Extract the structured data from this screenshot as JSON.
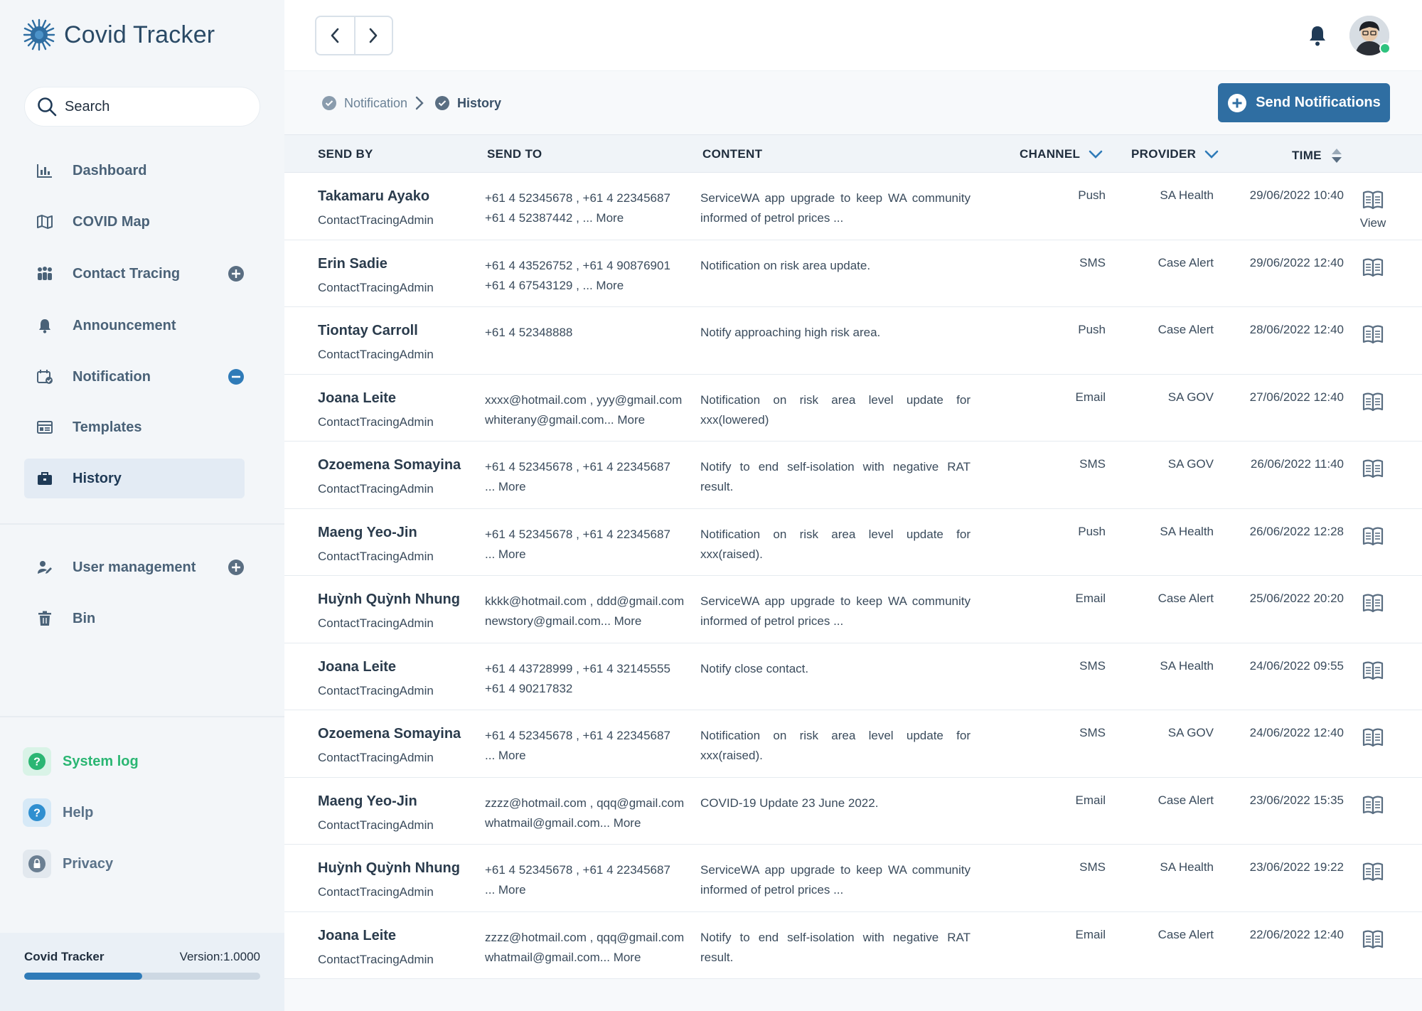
{
  "app": {
    "title": "Covid Tracker"
  },
  "search": {
    "placeholder": "Search"
  },
  "sidebar": {
    "items": [
      {
        "label": "Dashboard",
        "icon": "chart-icon",
        "badge": null,
        "active": false
      },
      {
        "label": "COVID Map",
        "icon": "map-icon",
        "badge": null,
        "active": false
      },
      {
        "label": "Contact Tracing",
        "icon": "people-icon",
        "badge": "plus-circle-icon",
        "active": false
      },
      {
        "label": "Announcement",
        "icon": "bell-icon",
        "badge": null,
        "active": false
      },
      {
        "label": "Notification",
        "icon": "calendar-check-icon",
        "badge": "minus-circle-icon",
        "active": false
      },
      {
        "label": "Templates",
        "icon": "template-icon",
        "badge": null,
        "active": false
      },
      {
        "label": "History",
        "icon": "briefcase-icon",
        "badge": null,
        "active": true
      }
    ],
    "admin_items": [
      {
        "label": "User management",
        "icon": "user-edit-icon",
        "badge": "plus-circle-icon"
      },
      {
        "label": "Bin",
        "icon": "trash-icon",
        "badge": null
      }
    ],
    "footer_items": [
      {
        "label": "System log",
        "icon": "question-icon",
        "color": "#2bb673"
      },
      {
        "label": "Help",
        "icon": "question-icon",
        "color": "#2f8fd0"
      },
      {
        "label": "Privacy",
        "icon": "lock-icon",
        "color": "#6b7f92"
      }
    ],
    "version": {
      "name": "Covid Tracker",
      "label": "Version:1.0000",
      "progress": 0.5
    }
  },
  "breadcrumb": {
    "parent": "Notification",
    "current": "History"
  },
  "actions": {
    "send_label": "Send Notifications"
  },
  "colors": {
    "accent": "#2f6ea2",
    "online": "#2ec27e"
  },
  "table": {
    "columns": {
      "send_by": "SEND BY",
      "send_to": "SEND TO",
      "content": "CONTENT",
      "channel": "CHANNEL",
      "provider": "PROVIDER",
      "time": "TIME"
    },
    "view_label": "View",
    "rows": [
      {
        "name": "Takamaru Ayako",
        "role": "ContactTracingAdmin",
        "to1": "+61 4 52345678 , +61 4 22345687",
        "to2": "+61 4 52387442 , ... More",
        "content": "ServiceWA app upgrade to keep WA community informed of petrol prices ...",
        "channel": "Push",
        "provider": "SA Health",
        "time": "29/06/2022 10:40",
        "show_view_label": true
      },
      {
        "name": "Erin Sadie",
        "role": "ContactTracingAdmin",
        "to1": "+61 4 43526752 , +61 4 90876901",
        "to2": "+61 4 67543129 , ... More",
        "content": "Notification on risk area update.",
        "channel": "SMS",
        "provider": "Case Alert",
        "time": "29/06/2022 12:40",
        "show_view_label": false
      },
      {
        "name": "Tiontay Carroll",
        "role": "ContactTracingAdmin",
        "to1": "+61 4 52348888",
        "to2": "",
        "content": "Notify approaching high risk area.",
        "channel": "Push",
        "provider": "Case Alert",
        "time": "28/06/2022 12:40",
        "show_view_label": false
      },
      {
        "name": "Joana Leite",
        "role": "ContactTracingAdmin",
        "to1": "xxxx@hotmail.com , yyy@gmail.com",
        "to2": "whiterany@gmail.com... More",
        "content": "Notification on risk area level update for xxx(lowered)",
        "channel": "Email",
        "provider": "SA GOV",
        "time": "27/06/2022 12:40",
        "show_view_label": false
      },
      {
        "name": "Ozoemena Somayina",
        "role": "ContactTracingAdmin",
        "to1": "+61 4 52345678 , +61 4 22345687",
        "to2": "... More",
        "content": "Notify to end self-isolation with negative RAT result.",
        "channel": "SMS",
        "provider": "SA GOV",
        "time": "26/06/2022 11:40",
        "show_view_label": false
      },
      {
        "name": "Maeng Yeo-Jin",
        "role": "ContactTracingAdmin",
        "to1": "+61 4 52345678 , +61 4 22345687",
        "to2": "... More",
        "content": "Notification on risk area level update for xxx(raised).",
        "channel": "Push",
        "provider": "SA Health",
        "time": "26/06/2022 12:28",
        "show_view_label": false
      },
      {
        "name": "Huỳnh Quỳnh Nhung",
        "role": "ContactTracingAdmin",
        "to1": "kkkk@hotmail.com , ddd@gmail.com",
        "to2": "newstory@gmail.com... More",
        "content": "ServiceWA app upgrade to keep WA community informed of petrol prices ...",
        "channel": "Email",
        "provider": "Case Alert",
        "time": "25/06/2022 20:20",
        "show_view_label": false
      },
      {
        "name": "Joana Leite",
        "role": "ContactTracingAdmin",
        "to1": "+61 4 43728999 , +61 4 32145555",
        "to2": "+61 4 90217832",
        "content": "Notify close contact.",
        "channel": "SMS",
        "provider": "SA Health",
        "time": "24/06/2022 09:55",
        "show_view_label": false
      },
      {
        "name": "Ozoemena Somayina",
        "role": "ContactTracingAdmin",
        "to1": "+61 4 52345678 , +61 4 22345687",
        "to2": "... More",
        "content": "Notification on risk area level update for xxx(raised).",
        "channel": "SMS",
        "provider": "SA GOV",
        "time": "24/06/2022 12:40",
        "show_view_label": false
      },
      {
        "name": "Maeng Yeo-Jin",
        "role": "ContactTracingAdmin",
        "to1": "zzzz@hotmail.com , qqq@gmail.com",
        "to2": "whatmail@gmail.com... More",
        "content": "COVID-19 Update 23 June 2022.",
        "channel": "Email",
        "provider": "Case Alert",
        "time": "23/06/2022 15:35",
        "show_view_label": false
      },
      {
        "name": "Huỳnh Quỳnh Nhung",
        "role": "ContactTracingAdmin",
        "to1": "+61 4 52345678 , +61 4 22345687",
        "to2": "... More",
        "content": "ServiceWA app upgrade to keep WA community informed of petrol prices ...",
        "channel": "SMS",
        "provider": "SA Health",
        "time": "23/06/2022 19:22",
        "show_view_label": false
      },
      {
        "name": "Joana Leite",
        "role": "ContactTracingAdmin",
        "to1": "zzzz@hotmail.com , qqq@gmail.com",
        "to2": "whatmail@gmail.com... More",
        "content": "Notify to end self-isolation with negative RAT result.",
        "channel": "Email",
        "provider": "Case Alert",
        "time": "22/06/2022 12:40",
        "show_view_label": false
      }
    ]
  }
}
